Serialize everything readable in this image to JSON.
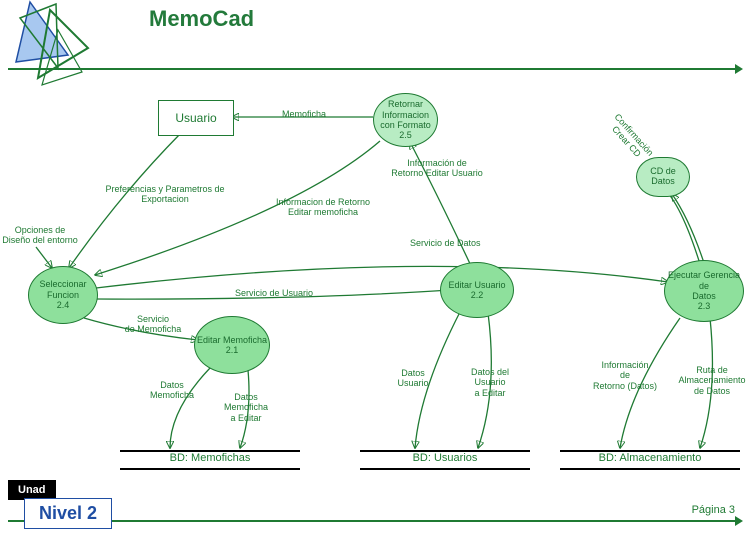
{
  "header": {
    "title": "MemoCad",
    "unad": "Unad",
    "level": "Nivel 2",
    "page": "Página 3"
  },
  "entities": {
    "usuario": "Usuario",
    "retornar": "Retornar\nInformacion\ncon Formato\n2.5",
    "cd": "CD de\nDatos",
    "seleccionar": "Seleccionar\nFuncion\n2.4",
    "editarMemo": "Editar Memoficha\n2.1",
    "editarUsuario": "Editar Usuario\n2.2",
    "ejecutar": "Ejecutar Gerencia\nde\nDatos\n2.3",
    "opciones": "Opciones de\nDiseño del entorno"
  },
  "datastores": {
    "ds1": "BD: Memofichas",
    "ds2": "BD: Usuarios",
    "ds3": "BD: Almacenamiento"
  },
  "flows": {
    "memoficha": "Memoficha",
    "infoRetUsuario": "Información de\nRetorno Editar Usuario",
    "confCrearCD": "Confirmación\nCrear CD",
    "prefParam": "Preferencias y Parametros de\nExportacion",
    "infoRetMemo": "Informacion de Retorno\nEditar memoficha",
    "servDatos": "Servicio de Datos",
    "servUsuario": "Servicio de Usuario",
    "servMemo": "Servicio\nde Memoficha",
    "datosMemo": "Datos\nMemoficha",
    "datosMemoEdit": "Datos\nMemoficha\na Editar",
    "datosUsuario": "Datos\nUsuario",
    "datosUsuarioEdit": "Datos del\nUsuario\na Editar",
    "infoRetDatos": "Información\nde\nRetorno (Datos)",
    "rutaAlm": "Ruta de\nAlmacenamiento\nde Datos"
  }
}
